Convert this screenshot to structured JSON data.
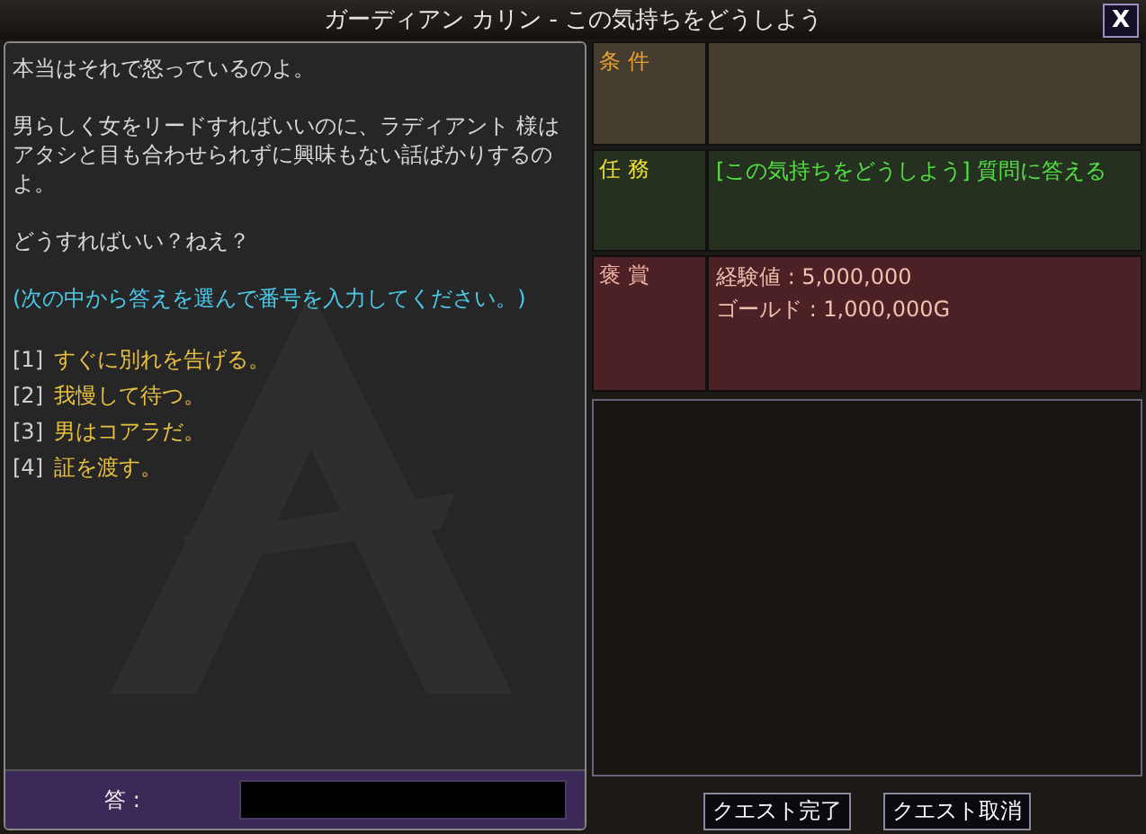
{
  "window": {
    "title": "ガーディアン カリン - この気持ちをどうしよう",
    "close": "X"
  },
  "dialogue": {
    "paragraphs": [
      "本当はそれで怒っているのよ。",
      "男らしく女をリードすればいいのに、ラディアント 様はアタシと目も合わせられずに興味もない話ばかりするのよ。",
      "どうすればいい？ねえ？"
    ],
    "instruction": "(次の中から答えを選んで番号を入力してください。)"
  },
  "options": [
    {
      "number": "[1]",
      "text": "すぐに別れを告げる。"
    },
    {
      "number": "[2]",
      "text": "我慢して待つ。"
    },
    {
      "number": "[3]",
      "text": "男はコアラだ。"
    },
    {
      "number": "[4]",
      "text": "証を渡す。"
    }
  ],
  "answer": {
    "label": "答 :"
  },
  "quest_info": [
    {
      "kind": "condition",
      "label": "条 件"
    },
    {
      "kind": "mission",
      "label": "任 務",
      "lines": [
        "[この気持ちをどうしよう] 質問に答える"
      ]
    },
    {
      "kind": "reward",
      "label": "褒 賞",
      "lines": [
        "経験値 : 5,000,000",
        "ゴールド : 1,000,000G"
      ]
    }
  ],
  "buttons": [
    "クエスト完了",
    "クエスト取消"
  ]
}
